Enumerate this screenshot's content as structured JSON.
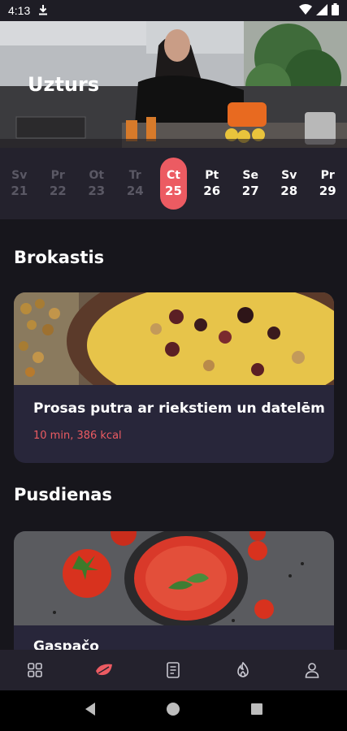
{
  "status": {
    "time": "4:13"
  },
  "header": {
    "title": "Uzturs"
  },
  "days": [
    {
      "weekday": "Sv",
      "date": "21",
      "state": "past"
    },
    {
      "weekday": "Pr",
      "date": "22",
      "state": "past"
    },
    {
      "weekday": "Ot",
      "date": "23",
      "state": "past"
    },
    {
      "weekday": "Tr",
      "date": "24",
      "state": "past"
    },
    {
      "weekday": "Ct",
      "date": "25",
      "state": "today"
    },
    {
      "weekday": "Pt",
      "date": "26",
      "state": "future"
    },
    {
      "weekday": "Se",
      "date": "27",
      "state": "future"
    },
    {
      "weekday": "Sv",
      "date": "28",
      "state": "future"
    },
    {
      "weekday": "Pr",
      "date": "29",
      "state": "future"
    }
  ],
  "meals": {
    "breakfast": {
      "section": "Brokastis",
      "name": "Prosas putra ar riekstiem un datelēm",
      "meta": "10 min, 386 kcal"
    },
    "lunch": {
      "section": "Pusdienas",
      "name": "Gaspačo"
    }
  },
  "bottom_nav": [
    "grid-icon",
    "leaf-icon",
    "document-icon",
    "flame-icon",
    "profile-icon"
  ],
  "colors": {
    "accent": "#ec5b62",
    "background": "#17161c",
    "card": "#28263a",
    "bar": "#24222d"
  }
}
